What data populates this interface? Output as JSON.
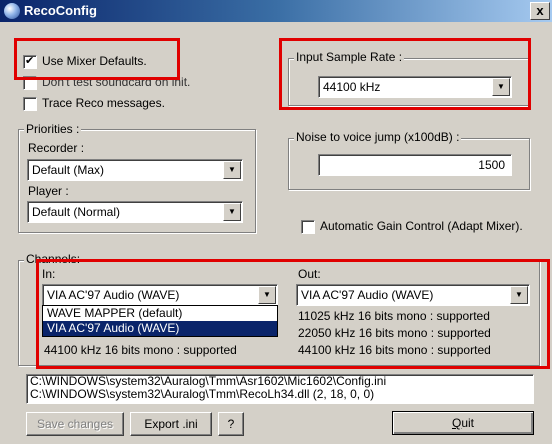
{
  "window": {
    "title": "RecoConfig",
    "close_label": "x"
  },
  "options": {
    "use_mixer_defaults": {
      "label": "Use Mixer Defaults.",
      "checked": true
    },
    "dont_test_soundcard": {
      "label": "Don't test soundcard on init.",
      "checked": false
    },
    "trace_reco": {
      "label": "Trace Reco messages.",
      "checked": false
    }
  },
  "priorities": {
    "legend": "Priorities :",
    "recorder_label": "Recorder :",
    "recorder_value": "Default (Max)",
    "player_label": "Player :",
    "player_value": "Default (Normal)"
  },
  "sample_rate": {
    "legend": "Input Sample Rate :",
    "value": "44100 kHz"
  },
  "noise": {
    "legend": "Noise to voice jump (x100dB) :",
    "value": "1500"
  },
  "agc": {
    "label": "Automatic Gain Control (Adapt Mixer).",
    "checked": false
  },
  "channels": {
    "legend": "Channels:",
    "in_label": "In:",
    "in_value": "VIA AC'97 Audio (WAVE)",
    "in_options": [
      "WAVE MAPPER (default)",
      "VIA AC'97 Audio (WAVE)"
    ],
    "in_selected_index": 1,
    "in_supported": [
      "44100 kHz 16 bits mono : supported"
    ],
    "out_label": "Out:",
    "out_value": "VIA AC'97 Audio (WAVE)",
    "out_supported": [
      "11025 kHz 16 bits mono : supported",
      "22050 kHz 16 bits mono : supported",
      "44100 kHz 16 bits mono : supported"
    ]
  },
  "paths": [
    "C:\\WINDOWS\\system32\\Auralog\\Tmm\\Asr1602\\Mic1602\\Config.ini",
    "C:\\WINDOWS\\system32\\Auralog\\Tmm\\RecoLh34.dll   (2, 18, 0, 0)"
  ],
  "buttons": {
    "save": "Save changes",
    "export": "Export .ini",
    "help": "?",
    "quit_accel": "Q",
    "quit_rest": "uit"
  },
  "colors": {
    "highlight": "#e00000",
    "titlebar": "#0a246a",
    "selection": "#0a246a"
  },
  "icons": {
    "app": "app-globe-icon",
    "dropdown": "chevron-down-icon",
    "check": "checkmark-icon"
  }
}
